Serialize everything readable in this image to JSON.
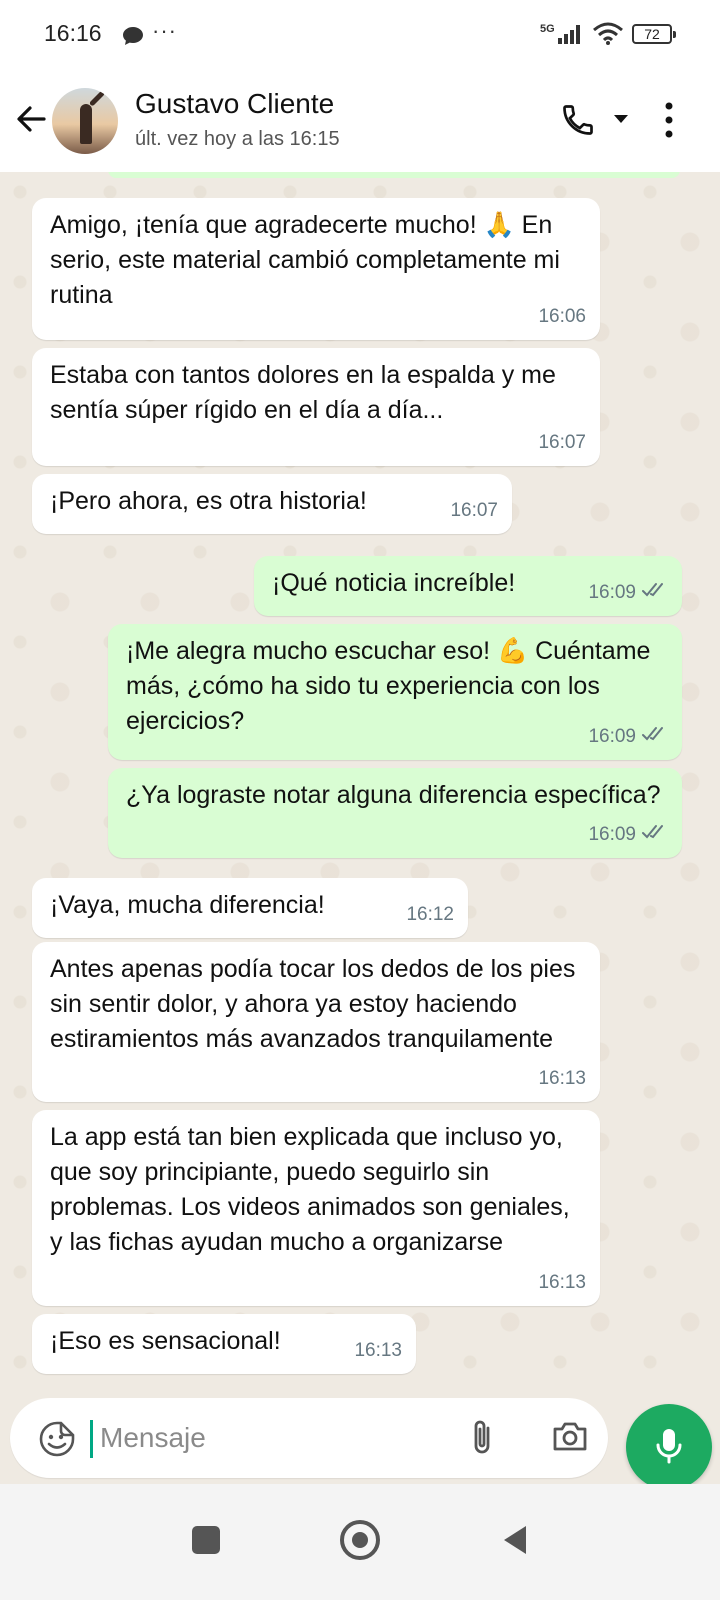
{
  "status_bar": {
    "time": "16:16",
    "dots": "···",
    "network": "5G",
    "battery": "72"
  },
  "header": {
    "contact_name": "Gustavo Cliente",
    "last_seen": "últ. vez hoy a las 16:15"
  },
  "messages": [
    {
      "direction": "in",
      "text": "Amigo, ¡tenía que agradecerte mucho! 🙏 En serio, este material cambió completamente mi rutina",
      "time": "16:06"
    },
    {
      "direction": "in",
      "text": "Estaba con tantos dolores en la espalda y me sentía súper rígido en el día a día...",
      "time": "16:07"
    },
    {
      "direction": "in",
      "text": "¡Pero ahora, es otra historia!",
      "time": "16:07"
    },
    {
      "direction": "out",
      "text": "¡Qué noticia increíble!",
      "time": "16:09",
      "status": "read"
    },
    {
      "direction": "out",
      "text": "¡Me alegra mucho escuchar eso! 💪 Cuéntame más, ¿cómo ha sido tu experiencia con los ejercicios?",
      "time": "16:09",
      "status": "read"
    },
    {
      "direction": "out",
      "text": "¿Ya lograste notar alguna diferencia específica?",
      "time": "16:09",
      "status": "read"
    },
    {
      "direction": "in",
      "text": "¡Vaya, mucha diferencia!",
      "time": "16:12"
    },
    {
      "direction": "in",
      "text": "Antes apenas podía tocar los dedos de los pies sin sentir dolor, y ahora ya estoy haciendo estiramientos más avanzados tranquilamente",
      "time": "16:13"
    },
    {
      "direction": "in",
      "text": "La app está tan bien explicada que incluso yo, que soy principiante, puedo seguirlo sin problemas. Los videos animados son geniales, y las fichas ayudan mucho a organizarse",
      "time": "16:13"
    },
    {
      "direction": "in",
      "text": "¡Eso es sensacional!",
      "time": "16:13"
    }
  ],
  "composer": {
    "placeholder": "Mensaje"
  },
  "colors": {
    "incoming": "#ffffff",
    "outgoing": "#d9fdd3",
    "accent": "#1daa61",
    "tick": "#667781"
  }
}
